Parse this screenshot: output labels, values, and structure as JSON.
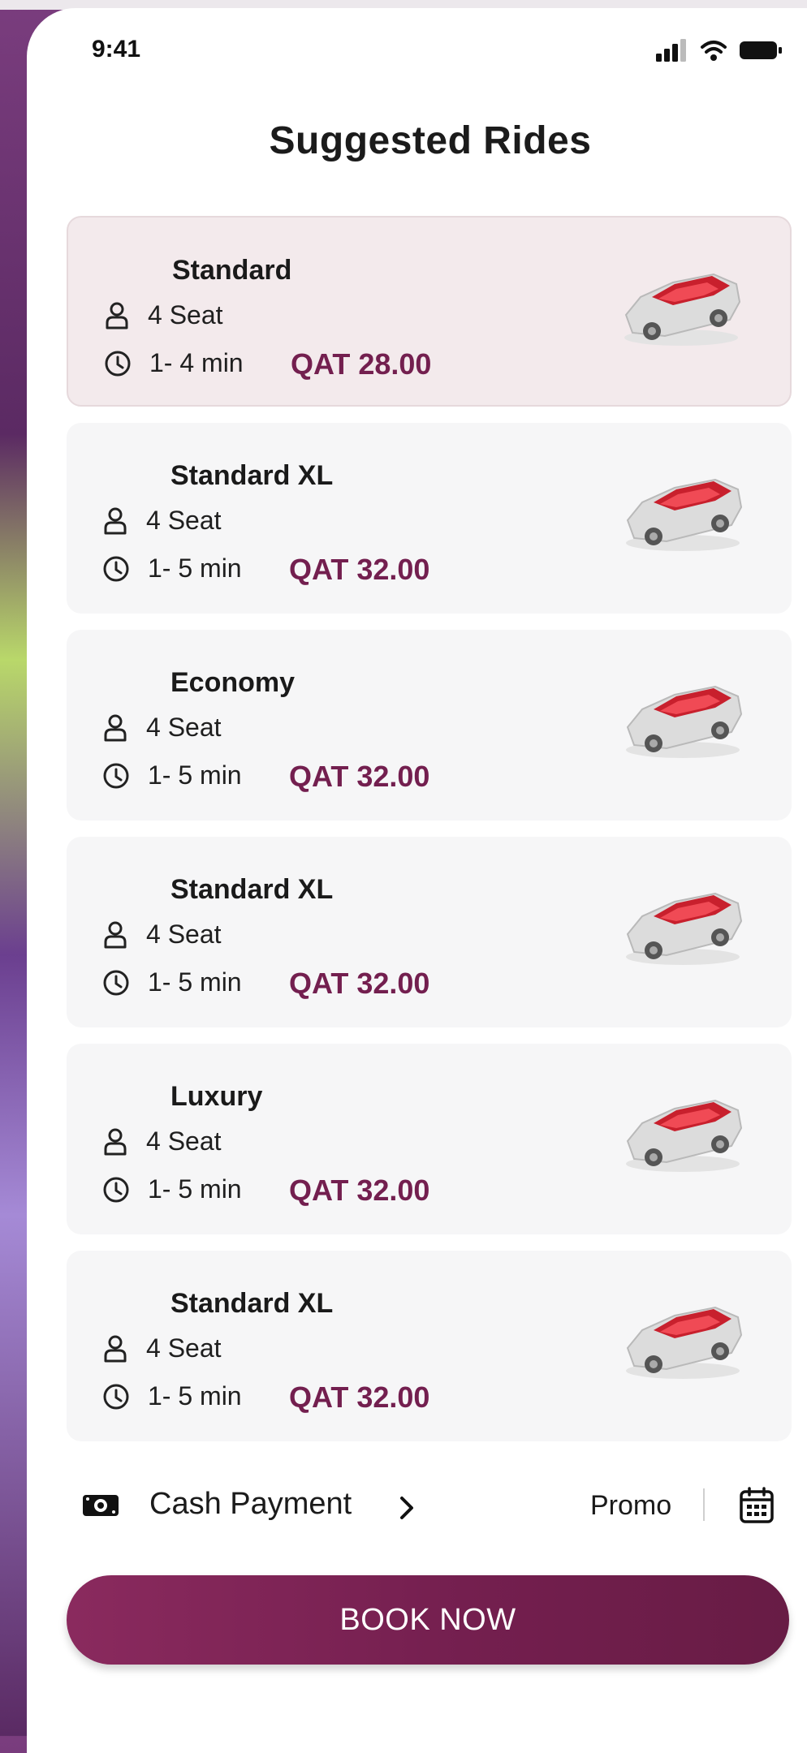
{
  "status": {
    "time": "9:41"
  },
  "title": "Suggested Rides",
  "rides": [
    {
      "name": "Standard",
      "seats": "4 Seat",
      "eta": "1- 4 min",
      "price": "QAT 28.00",
      "selected": true
    },
    {
      "name": "Standard XL",
      "seats": "4 Seat",
      "eta": "1- 5 min",
      "price": "QAT 32.00",
      "selected": false
    },
    {
      "name": "Economy",
      "seats": "4 Seat",
      "eta": "1- 5 min",
      "price": "QAT 32.00",
      "selected": false
    },
    {
      "name": "Standard XL",
      "seats": "4 Seat",
      "eta": "1- 5 min",
      "price": "QAT 32.00",
      "selected": false
    },
    {
      "name": "Luxury",
      "seats": "4 Seat",
      "eta": "1- 5 min",
      "price": "QAT 32.00",
      "selected": false
    },
    {
      "name": "Standard XL",
      "seats": "4 Seat",
      "eta": "1- 5 min",
      "price": "QAT 32.00",
      "selected": false
    }
  ],
  "payment": {
    "label": "Cash Payment",
    "promo": "Promo"
  },
  "book_button": "BOOK NOW",
  "colors": {
    "brand": "#731f4f",
    "selected_card": "#f3eaec",
    "card": "#f6f6f7"
  },
  "icons": [
    "seat-icon",
    "clock-icon",
    "car-icon",
    "cash-icon",
    "chevron-right-icon",
    "calendar-icon",
    "signal-icon",
    "wifi-icon",
    "battery-icon"
  ]
}
